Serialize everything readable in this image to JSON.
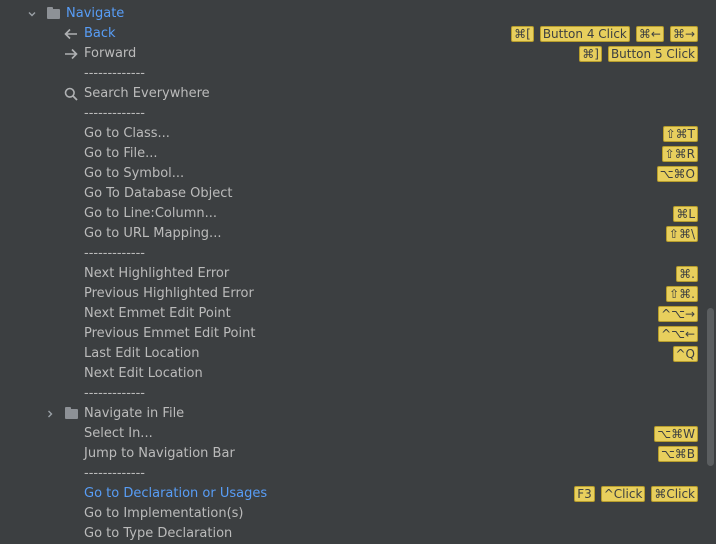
{
  "tree": {
    "root": {
      "label": "Navigate"
    },
    "items": [
      {
        "label": "Back",
        "icon": "arrow-left-icon",
        "link": true,
        "shortcuts": [
          "⌘[",
          "Button 4 Click",
          "⌘←",
          "⌘→"
        ]
      },
      {
        "label": "Forward",
        "icon": "arrow-right-icon",
        "shortcuts": [
          "⌘]",
          "Button 5 Click"
        ]
      },
      {
        "label": "-------------",
        "sep": true
      },
      {
        "label": "Search Everywhere",
        "icon": "search-icon",
        "shortcuts": []
      },
      {
        "label": "-------------",
        "sep": true
      },
      {
        "label": "Go to Class...",
        "shortcuts": [
          "⇧⌘T"
        ]
      },
      {
        "label": "Go to File...",
        "shortcuts": [
          "⇧⌘R"
        ]
      },
      {
        "label": "Go to Symbol...",
        "shortcuts": [
          "⌥⌘O"
        ]
      },
      {
        "label": "Go To Database Object",
        "shortcuts": []
      },
      {
        "label": "Go to Line:Column...",
        "shortcuts": [
          "⌘L"
        ]
      },
      {
        "label": "Go to URL Mapping...",
        "shortcuts": [
          "⇧⌘\\"
        ]
      },
      {
        "label": "-------------",
        "sep": true
      },
      {
        "label": "Next Highlighted Error",
        "shortcuts": [
          "⌘."
        ]
      },
      {
        "label": "Previous Highlighted Error",
        "shortcuts": [
          "⇧⌘."
        ]
      },
      {
        "label": "Next Emmet Edit Point",
        "shortcuts": [
          "^⌥→"
        ]
      },
      {
        "label": "Previous Emmet Edit Point",
        "shortcuts": [
          "^⌥←"
        ]
      },
      {
        "label": "Last Edit Location",
        "shortcuts": [
          "^Q"
        ]
      },
      {
        "label": "Next Edit Location",
        "shortcuts": []
      },
      {
        "label": "-------------",
        "sep": true
      },
      {
        "label": "Navigate in File",
        "group": true,
        "shortcuts": []
      },
      {
        "label": "Select In...",
        "shortcuts": [
          "⌥⌘W"
        ]
      },
      {
        "label": "Jump to Navigation Bar",
        "shortcuts": [
          "⌥⌘B"
        ]
      },
      {
        "label": "-------------",
        "sep": true
      },
      {
        "label": "Go to Declaration or Usages",
        "link": true,
        "shortcuts": [
          "F3",
          "^Click",
          "⌘Click"
        ]
      },
      {
        "label": "Go to Implementation(s)",
        "shortcuts": []
      },
      {
        "label": "Go to Type Declaration",
        "shortcuts": []
      }
    ]
  },
  "colors": {
    "background": "#3c3f41",
    "text": "#bbbbbb",
    "link": "#589df6",
    "shortcut_bg": "#e8cf5d"
  }
}
